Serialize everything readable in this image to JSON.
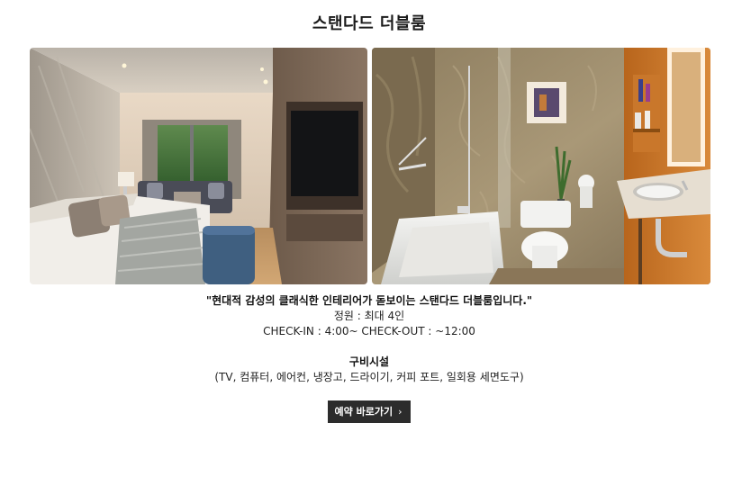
{
  "room": {
    "title": "스탠다드 더블룸",
    "tagline": "\"현대적 감성의 클래식한 인테리어가 돋보이는 스탠다드 더블룸입니다.\"",
    "capacity": "정원 : 최대 4인",
    "checkin_checkout": "CHECK-IN : 4:00~ CHECK-OUT : ~12:00",
    "amenities_title": "구비시설",
    "amenities_list": "(TV, 컴퓨터, 에어컨, 냉장고, 드라이기, 커피 포트, 일회용 세면도구)"
  },
  "reserve_button": {
    "label": "예약 바로가기",
    "icon": "chevron-right-icon",
    "chevron": "›"
  }
}
